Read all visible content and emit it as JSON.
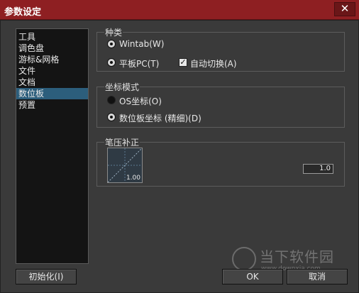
{
  "window": {
    "title": "参数设定",
    "close_glyph": "✕"
  },
  "sidebar": {
    "items": [
      {
        "label": "工具"
      },
      {
        "label": "调色盘"
      },
      {
        "label": "游标&网格"
      },
      {
        "label": "文件"
      },
      {
        "label": "文档"
      },
      {
        "label": "数位板"
      },
      {
        "label": "预置"
      }
    ],
    "selected": "数位板"
  },
  "type_group": {
    "title": "种类",
    "wintab_label": "Wintab(W)",
    "tablet_pc_label": "平板PC(T)",
    "auto_switch_label": "自动切换(A)",
    "auto_switch_checked": true,
    "check_glyph": "✓"
  },
  "coord_group": {
    "title": "坐标模式",
    "os_label": "OS坐标(O)",
    "tablet_label": "数位板坐标 (精细)(D)"
  },
  "pressure_group": {
    "title": "笔压补正",
    "curve_value": "1.00",
    "field_value": "1.0"
  },
  "buttons": {
    "init": "初始化(I)",
    "ok": "OK",
    "cancel": "取消"
  },
  "watermark": {
    "text": "当下软件园",
    "url": "www.downxia.com"
  }
}
